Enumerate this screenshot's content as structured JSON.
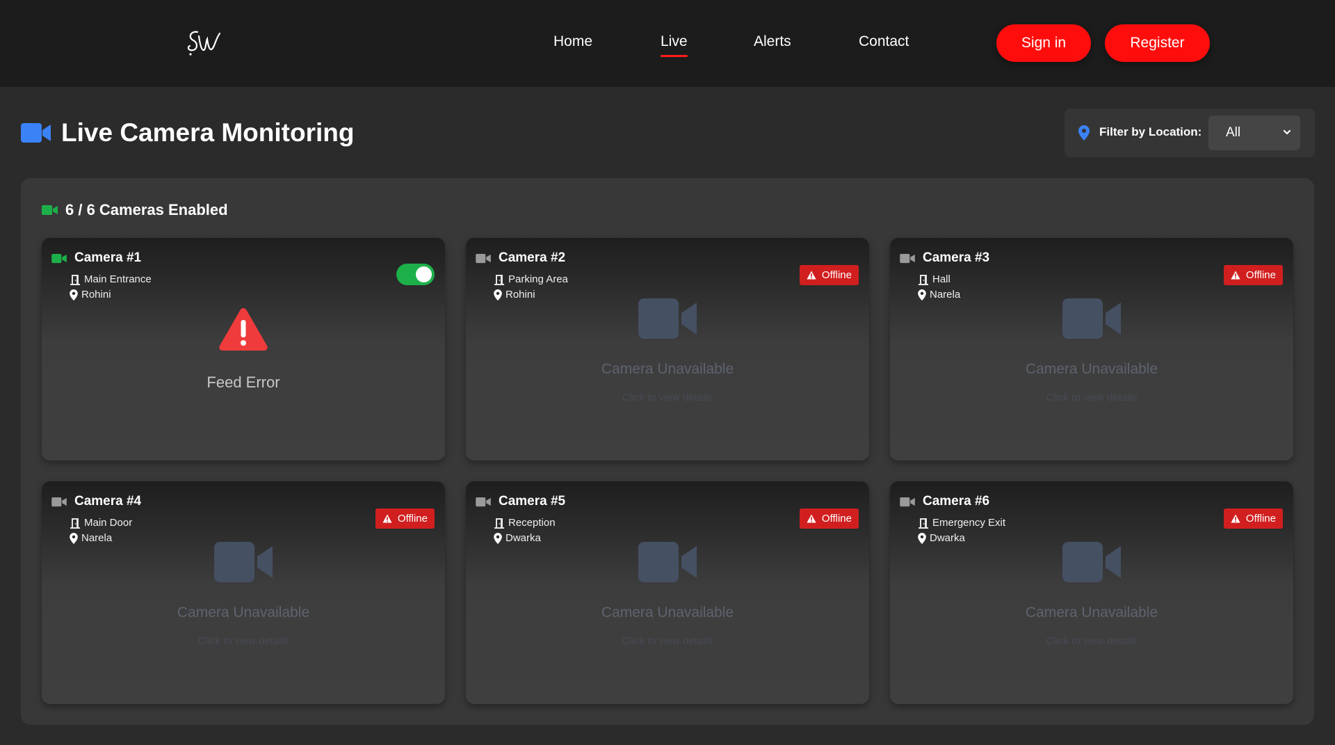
{
  "header": {
    "nav": [
      "Home",
      "Live",
      "Alerts",
      "Contact"
    ],
    "active_nav": "Live",
    "signin_label": "Sign in",
    "register_label": "Register"
  },
  "page": {
    "title": "Live Camera Monitoring",
    "filter_label": "Filter by Location:",
    "filter_value": "All"
  },
  "summary": {
    "enabled_text": "6 / 6 Cameras Enabled"
  },
  "cameras": [
    {
      "title": "Camera #1",
      "area": "Main Entrance",
      "location": "Rohini",
      "status": "error",
      "status_text": "Feed Error",
      "enabled": true
    },
    {
      "title": "Camera #2",
      "area": "Parking Area",
      "location": "Rohini",
      "status": "offline",
      "badge": "Offline",
      "message": "Camera Unavailable",
      "hint": "Click to view details"
    },
    {
      "title": "Camera #3",
      "area": "Hall",
      "location": "Narela",
      "status": "offline",
      "badge": "Offline",
      "message": "Camera Unavailable",
      "hint": "Click to view details"
    },
    {
      "title": "Camera #4",
      "area": "Main Door",
      "location": "Narela",
      "status": "offline",
      "badge": "Offline",
      "message": "Camera Unavailable",
      "hint": "Click to view details"
    },
    {
      "title": "Camera #5",
      "area": "Reception",
      "location": "Dwarka",
      "status": "offline",
      "badge": "Offline",
      "message": "Camera Unavailable",
      "hint": "Click to view details"
    },
    {
      "title": "Camera #6",
      "area": "Emergency Exit",
      "location": "Dwarka",
      "status": "offline",
      "badge": "Offline",
      "message": "Camera Unavailable",
      "hint": "Click to view details"
    }
  ],
  "colors": {
    "accent_red": "#ff0d0d",
    "offline_red": "#d11f1f",
    "enabled_green": "#1db04a",
    "title_icon_blue": "#3b82f6",
    "location_pin_blue": "#3b82f6"
  },
  "icons": {
    "logo": "sw-logo",
    "title": "video-camera-icon",
    "filter": "location-pin-icon",
    "meta_area": "door-icon",
    "meta_location": "location-pin-icon",
    "badge": "warning-triangle-icon"
  }
}
